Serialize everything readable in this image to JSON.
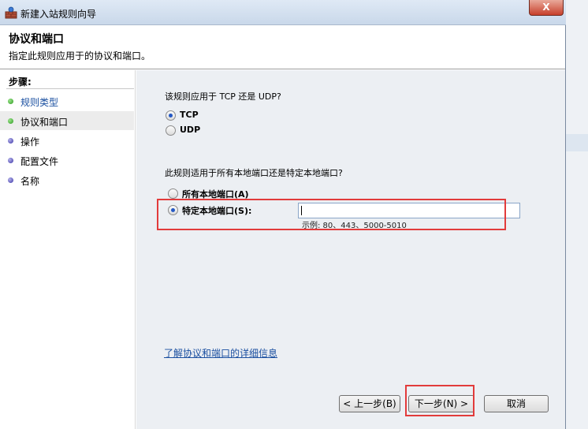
{
  "window": {
    "title": "新建入站规则向导",
    "close_label": "X"
  },
  "header": {
    "title": "协议和端口",
    "subtitle": "指定此规则应用于的协议和端口。"
  },
  "sidebar": {
    "title": "步骤:",
    "items": [
      {
        "label": "规则类型",
        "state": "done"
      },
      {
        "label": "协议和端口",
        "state": "current"
      },
      {
        "label": "操作",
        "state": "todo"
      },
      {
        "label": "配置文件",
        "state": "todo"
      },
      {
        "label": "名称",
        "state": "todo"
      }
    ]
  },
  "protocol": {
    "question": "该规则应用于 TCP 还是 UDP?",
    "options": [
      {
        "label": "TCP",
        "checked": true
      },
      {
        "label": "UDP",
        "checked": false
      }
    ]
  },
  "ports": {
    "question": "此规则适用于所有本地端口还是特定本地端口?",
    "options": [
      {
        "label": "所有本地端口(A)",
        "checked": false
      },
      {
        "label": "特定本地端口(S):",
        "checked": true
      }
    ],
    "input_value": "",
    "example": "示例: 80、443、5000-5010"
  },
  "info_link": "了解协议和端口的详细信息",
  "buttons": {
    "back": "< 上一步(B)",
    "next": "下一步(N) >",
    "cancel": "取消"
  },
  "colors": {
    "highlight": "#e23b3b",
    "link": "#1a4fa0",
    "close": "#c7402b"
  },
  "icons": {
    "window": "firewall-icon"
  }
}
